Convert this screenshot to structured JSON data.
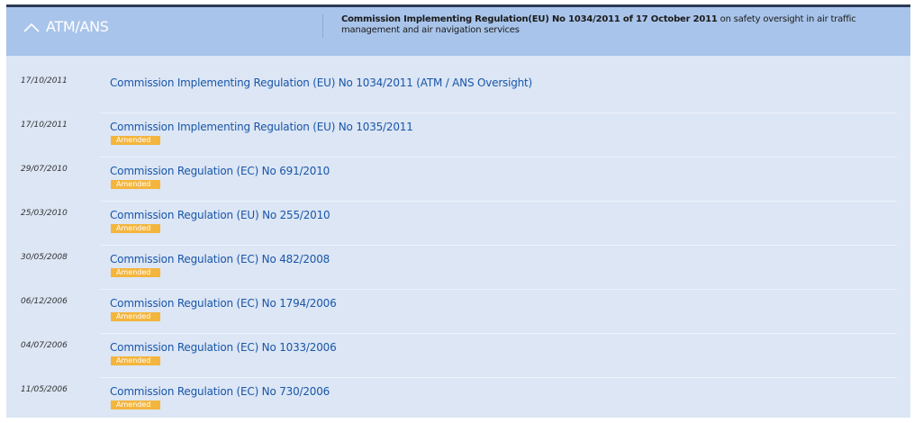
{
  "header": {
    "title": "ATM/ANS",
    "description_bold": "Commission Implementing Regulation(EU) No 1034/2011 of 17 October 2011",
    "description_rest": " on safety oversight in air traffic management and air navigation services"
  },
  "items": [
    {
      "date": "17/10/2011",
      "title": "Commission Implementing Regulation (EU) No 1034/2011 (ATM / ANS Oversight)",
      "badge": ""
    },
    {
      "date": "17/10/2011",
      "title": "Commission Implementing Regulation (EU) No 1035/2011",
      "badge": "Amended"
    },
    {
      "date": "29/07/2010",
      "title": "Commission Regulation (EC) No 691/2010",
      "badge": "Amended"
    },
    {
      "date": "25/03/2010",
      "title": "Commission Regulation (EU) No 255/2010",
      "badge": "Amended"
    },
    {
      "date": "30/05/2008",
      "title": "Commission Regulation (EC) No 482/2008",
      "badge": "Amended"
    },
    {
      "date": "06/12/2006",
      "title": "Commission Regulation (EC) No 1794/2006",
      "badge": "Amended"
    },
    {
      "date": "04/07/2006",
      "title": "Commission Regulation (EC) No 1033/2006",
      "badge": "Amended"
    },
    {
      "date": "11/05/2006",
      "title": "Commission Regulation (EC) No 730/2006",
      "badge": "Amended"
    }
  ],
  "colors": {
    "header_bg": "#a9c4ea",
    "panel_bg": "#dce6f5",
    "link": "#1a56a8",
    "badge": "#f4b53d"
  },
  "icons": {
    "toggle": "chevron-up-icon"
  }
}
